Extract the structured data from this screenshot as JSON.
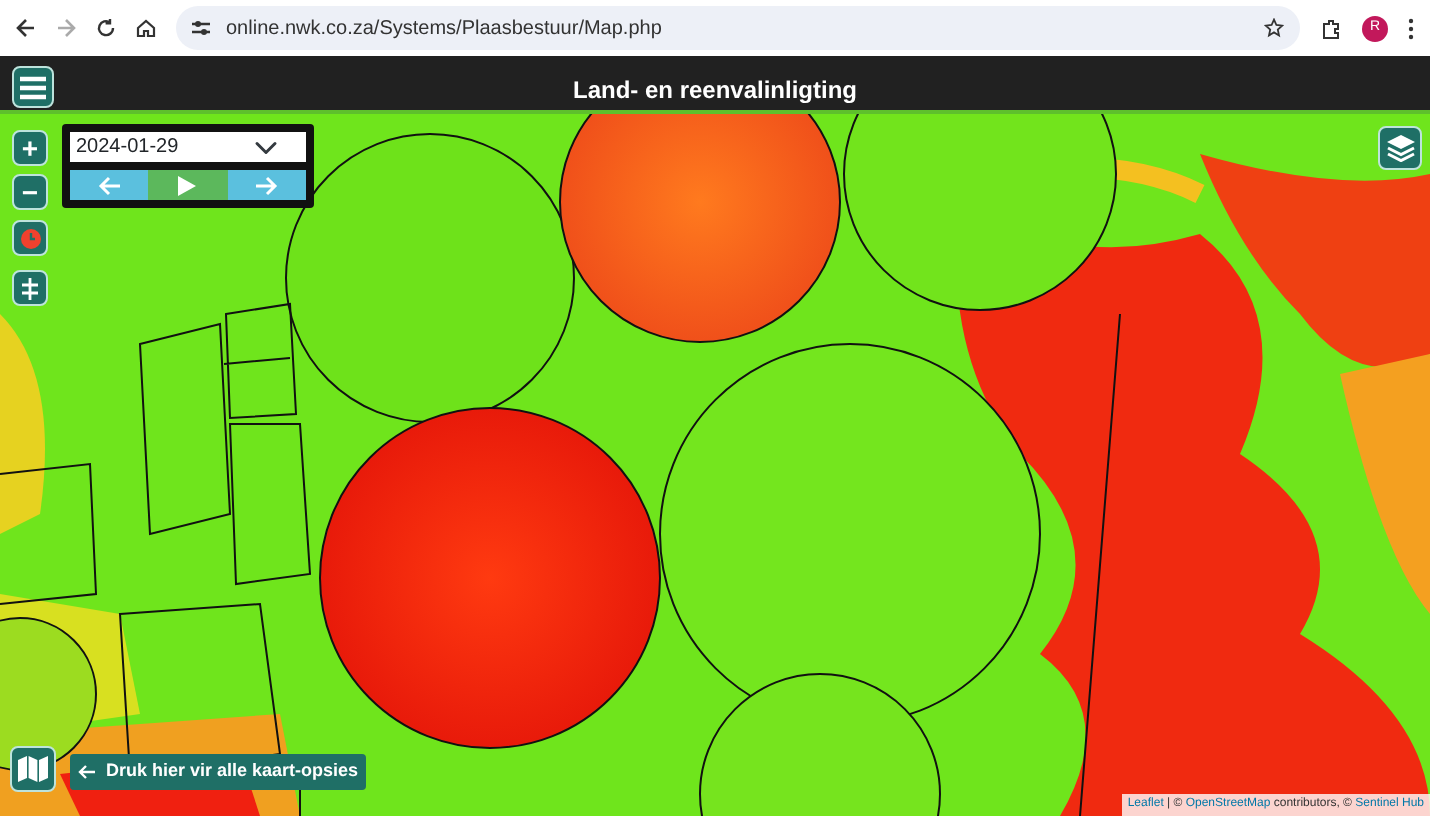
{
  "browser": {
    "url": "online.nwk.co.za/Systems/Plaasbestuur/Map.php",
    "profile_initial": "R"
  },
  "header": {
    "title": "Land- en reenvalinligting"
  },
  "zoom_controls": [
    "+",
    "−"
  ],
  "date_picker": {
    "value": "2024-01-29"
  },
  "map_hint": {
    "text": "Druk hier vir alle kaart-opsies"
  },
  "attribution": [
    {
      "text": "Leaflet",
      "link": true
    },
    {
      "text": " | © ",
      "link": false
    },
    {
      "text": "OpenStreetMap",
      "link": true
    },
    {
      "text": " contributors, © ",
      "link": false
    },
    {
      "text": "Sentinel Hub",
      "link": true
    }
  ]
}
